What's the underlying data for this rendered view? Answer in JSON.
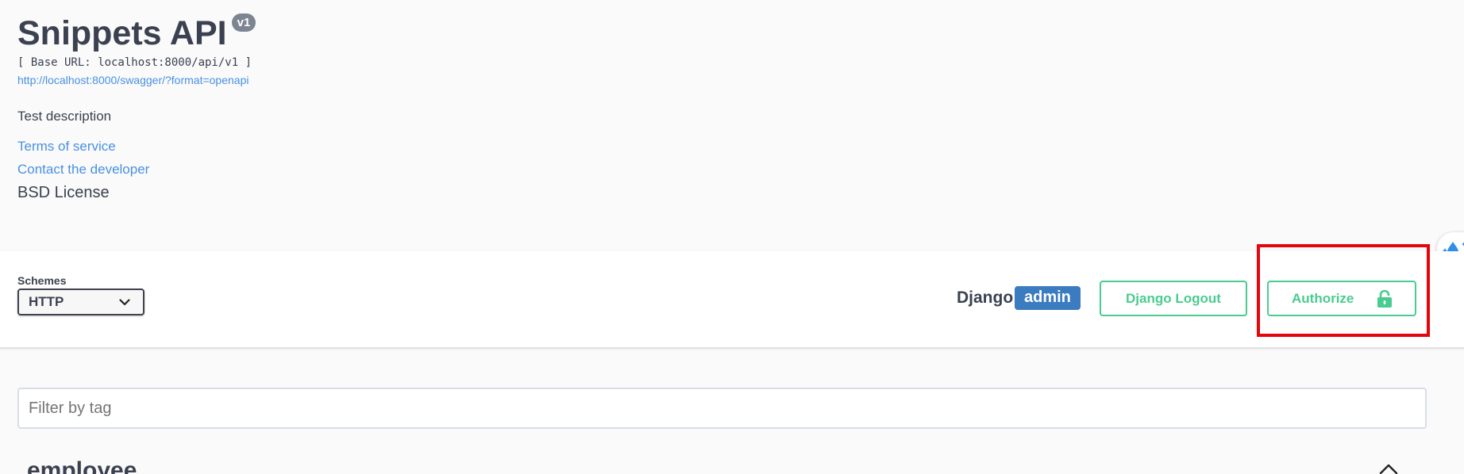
{
  "info": {
    "title": "Snippets API",
    "version": "v1",
    "base_url": "[ Base URL: localhost:8000/api/v1 ]",
    "spec_url": "http://localhost:8000/swagger/?format=openapi",
    "description": "Test description",
    "terms_of_service": "Terms of service",
    "contact": "Contact the developer",
    "license": "BSD License"
  },
  "schemes": {
    "label": "Schemes",
    "selected": "HTTP"
  },
  "auth": {
    "user_label": "Django",
    "user_badge": "admin",
    "logout_label": "Django Logout",
    "authorize_label": "Authorize"
  },
  "filter": {
    "placeholder": "Filter by tag",
    "value": ""
  },
  "tags": [
    {
      "name": "employee"
    }
  ],
  "colors": {
    "accent_green": "#49cc90",
    "link_blue": "#4990e2",
    "badge_blue": "#3b7bbf",
    "highlight_red": "#e5060b",
    "version_gray": "#7d8492"
  },
  "icons": {
    "lock": "lock-open-icon",
    "chevron": "chevron-down-icon",
    "tag_toggle": "chevron-up-icon",
    "side_tab": "water-drop-sparkle-icon"
  }
}
